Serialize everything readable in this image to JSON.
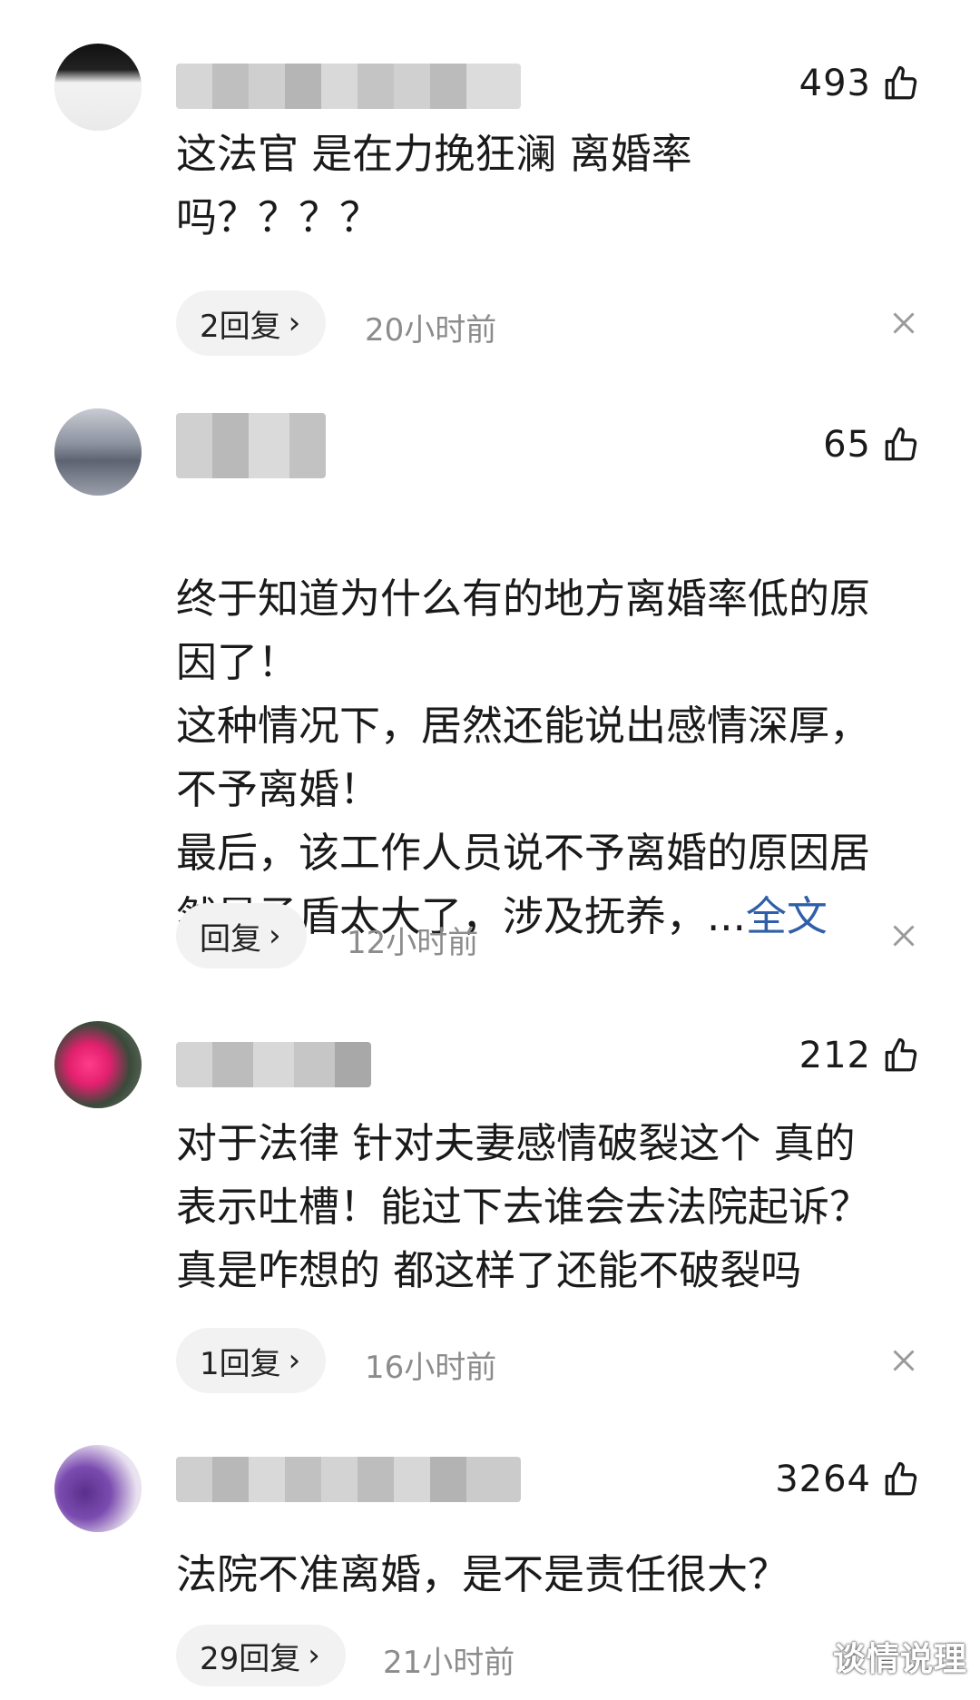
{
  "comments": [
    {
      "likes": "493",
      "text": "这法官 是在力挽狂澜 离婚率\n吗？？？？",
      "reply_label": "2回复",
      "time": "20小时前"
    },
    {
      "likes": "65",
      "text": "终于知道为什么有的地方离婚率低的原\n因了！\n这种情况下，居然还能说出感情深厚，\n不予离婚！\n最后，该工作人员说不予离婚的原因居\n然是矛盾太大了，涉及抚养，...",
      "more_label": "全文",
      "reply_label": "回复",
      "time": "12小时前"
    },
    {
      "likes": "212",
      "text": "对于法律 针对夫妻感情破裂这个 真的\n表示吐槽！能过下去谁会去法院起诉？\n真是咋想的 都这样了还能不破裂吗",
      "reply_label": "1回复",
      "time": "16小时前"
    },
    {
      "likes": "3264",
      "text": "法院不准离婚，是不是责任很大？",
      "reply_label": "29回复",
      "time": "21小时前"
    }
  ],
  "icons": {
    "like": "thumbs-up-icon",
    "close": "close-icon",
    "chevron": "chevron-right-icon"
  },
  "chevron_glyph": "›",
  "watermark": "谈情说理",
  "colors": {
    "text": "#1a1a1a",
    "secondary": "#8c8c8c",
    "link": "#2f5fa8",
    "pill_bg": "#f2f2f2"
  }
}
